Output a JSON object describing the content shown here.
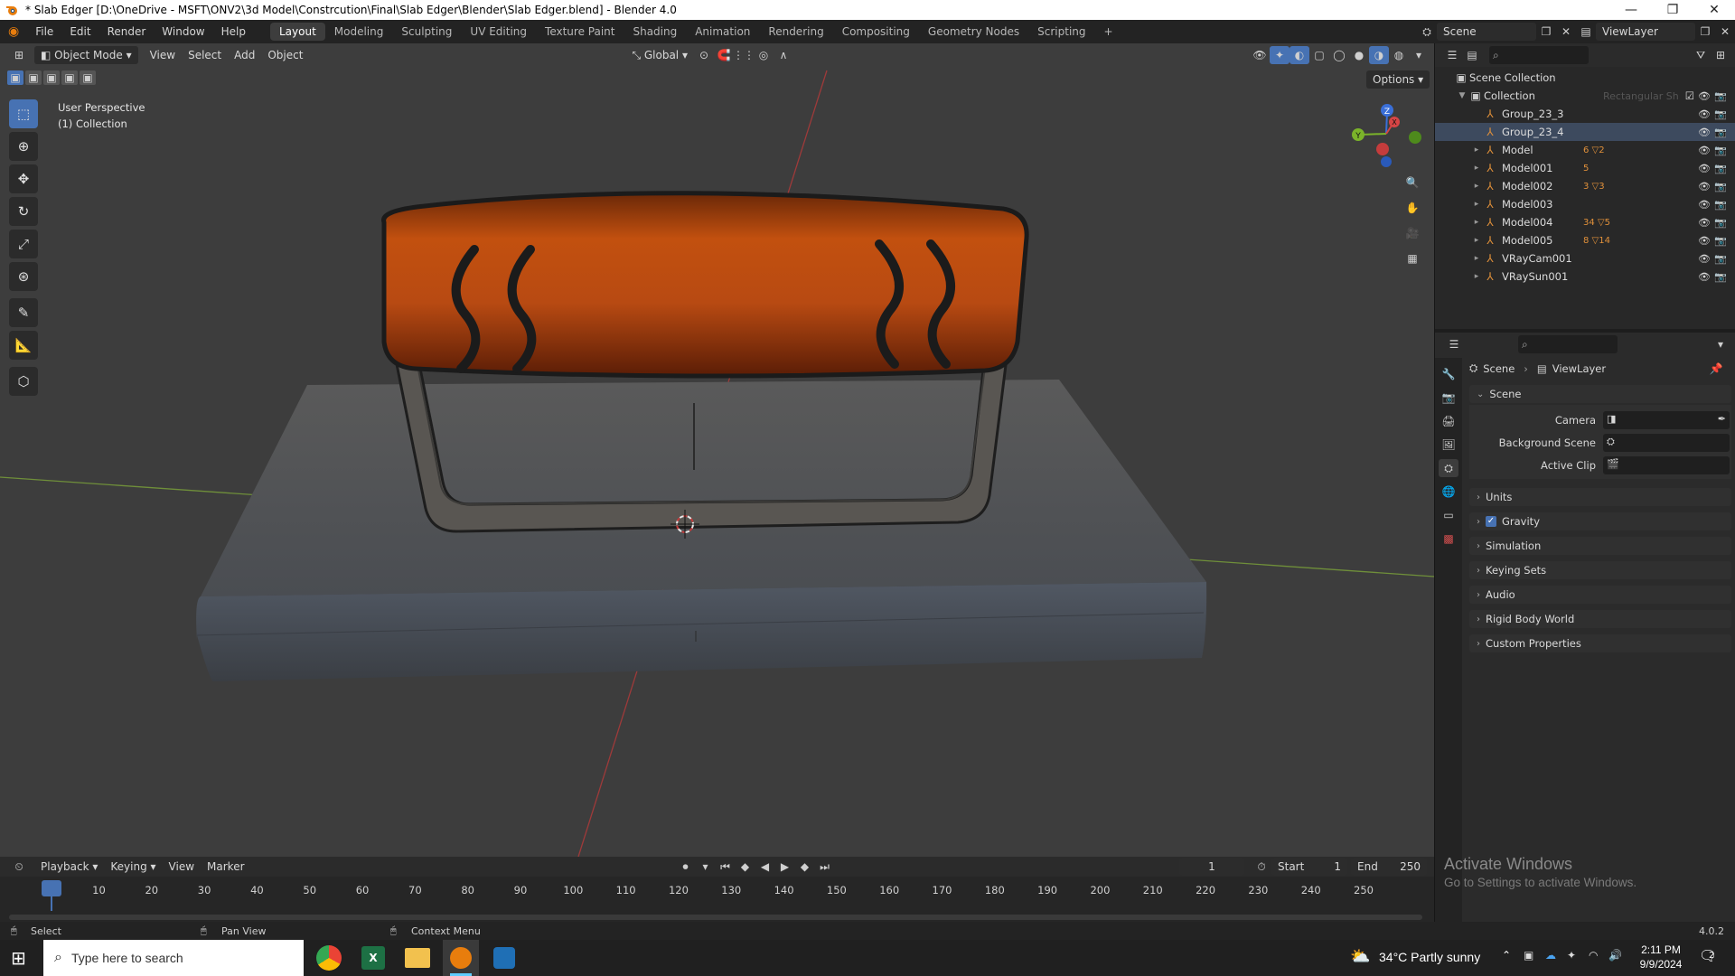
{
  "window": {
    "title": "* Slab Edger [D:\\OneDrive - MSFT\\ONV2\\3d Model\\Constrcution\\Final\\Slab Edger\\Blender\\Slab Edger.blend] - Blender 4.0",
    "minimize": "—",
    "maximize": "❐",
    "close": "✕"
  },
  "menu": {
    "items": [
      "File",
      "Edit",
      "Render",
      "Window",
      "Help"
    ],
    "workspaces": [
      "Layout",
      "Modeling",
      "Sculpting",
      "UV Editing",
      "Texture Paint",
      "Shading",
      "Animation",
      "Rendering",
      "Compositing",
      "Geometry Nodes",
      "Scripting"
    ],
    "add_workspace": "+",
    "scene_label": "Scene",
    "viewlayer_label": "ViewLayer"
  },
  "viewport": {
    "mode": "Object Mode",
    "menus": [
      "View",
      "Select",
      "Add",
      "Object"
    ],
    "orientation": "Global",
    "options_label": "Options",
    "overlay_line1": "User Perspective",
    "overlay_line2": "(1) Collection",
    "gizmo_labels": {
      "z": "Z",
      "y": "Y",
      "x": "X"
    }
  },
  "outliner": {
    "root": "Scene Collection",
    "collection": "Collection",
    "ghost_text": "Rectangular Sh",
    "items": [
      {
        "name": "Group_23_3",
        "extra": ""
      },
      {
        "name": "Group_23_4",
        "extra": ""
      },
      {
        "name": "Model",
        "extra": "6 ▽2"
      },
      {
        "name": "Model001",
        "extra": "5"
      },
      {
        "name": "Model002",
        "extra": "3 ▽3"
      },
      {
        "name": "Model003",
        "extra": ""
      },
      {
        "name": "Model004",
        "extra": "34 ▽5"
      },
      {
        "name": "Model005",
        "extra": "8 ▽14"
      },
      {
        "name": "VRayCam001",
        "extra": ""
      },
      {
        "name": "VRaySun001",
        "extra": ""
      }
    ]
  },
  "properties": {
    "breadcrumb_scene": "Scene",
    "breadcrumb_viewlayer": "ViewLayer",
    "section": "Scene",
    "fields": [
      {
        "label": "Camera"
      },
      {
        "label": "Background Scene"
      },
      {
        "label": "Active Clip"
      }
    ],
    "panels": [
      "Units",
      "Gravity",
      "Simulation",
      "Keying Sets",
      "Audio",
      "Rigid Body World",
      "Custom Properties"
    ]
  },
  "timeline": {
    "menus": [
      "Playback",
      "Keying",
      "View",
      "Marker"
    ],
    "current_frame": "1",
    "start_label": "Start",
    "start_value": "1",
    "end_label": "End",
    "end_value": "250",
    "ticks": [
      "1",
      "10",
      "20",
      "30",
      "40",
      "50",
      "60",
      "70",
      "80",
      "90",
      "100",
      "110",
      "120",
      "130",
      "140",
      "150",
      "160",
      "170",
      "180",
      "190",
      "200",
      "210",
      "220",
      "230",
      "240",
      "250"
    ]
  },
  "watermark": {
    "line1": "Activate Windows",
    "line2": "Go to Settings to activate Windows."
  },
  "statusbar": {
    "select": "Select",
    "pan": "Pan View",
    "context": "Context Menu",
    "version": "4.0.2"
  },
  "taskbar": {
    "search_placeholder": "Type here to search",
    "weather": "34°C  Partly sunny",
    "time": "2:11 PM",
    "date": "9/9/2024",
    "notif_count": "2"
  },
  "colors": {
    "accent": "#4772b3",
    "handle": "#b84a12",
    "viewport_bg": "#3d3d3d",
    "object_orange": "#e0903a"
  }
}
